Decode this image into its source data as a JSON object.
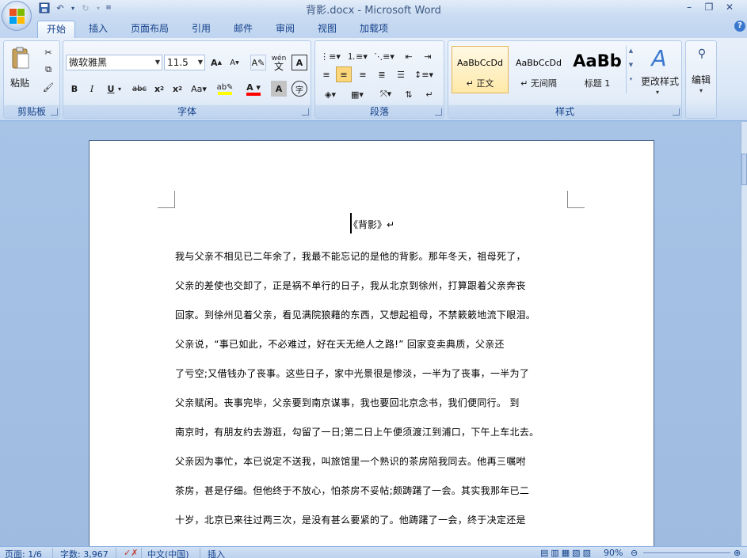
{
  "window": {
    "title": "背影.docx - Microsoft Word"
  },
  "tabs": [
    "开始",
    "插入",
    "页面布局",
    "引用",
    "邮件",
    "审阅",
    "视图",
    "加载项"
  ],
  "ribbon": {
    "clipboard": {
      "label": "剪贴板",
      "paste": "粘贴"
    },
    "font": {
      "label": "字体",
      "name": "微软雅黑",
      "size": "11.5",
      "phonetic": "wén",
      "phonetic_char": "文"
    },
    "paragraph": {
      "label": "段落"
    },
    "styles": {
      "label": "样式",
      "items": [
        {
          "sample": "AaBbCcDd",
          "name": "↵ 正文"
        },
        {
          "sample": "AaBbCcDd",
          "name": "↵ 无间隔"
        },
        {
          "sample": "AaBb",
          "name": "标题 1"
        }
      ],
      "change": "更改样式"
    },
    "editing": {
      "label": "编辑"
    }
  },
  "document": {
    "title": "《背影》↵",
    "lines": [
      "我与父亲不相见已二年余了，我最不能忘记的是他的背影。那年冬天，祖母死了，",
      "父亲的差使也交卸了，正是祸不单行的日子，我从北京到徐州，打算跟着父亲奔丧",
      "回家。到徐州见着父亲，看见满院狼藉的东西，又想起祖母，不禁簌簌地流下眼泪。",
      "父亲说，“事已如此，不必难过，好在天无绝人之路!”          回家变卖典质，父亲还",
      "了亏空;又借钱办了丧事。这些日子，家中光景很是惨淡，一半为了丧事，一半为了",
      "父亲赋闲。丧事完毕，父亲要到南京谋事，我也要回北京念书，我们便同行。          到",
      "南京时，有朋友约去游逛，勾留了一日;第二日上午便须渡江到浦口，下午上车北去。",
      "父亲因为事忙，本已说定不送我，叫旅馆里一个熟识的茶房陪我同去。他再三嘱咐",
      "茶房，甚是仔细。但他终于不放心，怕茶房不妥帖;颇踌躇了一会。其实我那年已二",
      "十岁，北京已来往过两三次，是没有甚么要紧的了。他踌躇了一会，终于决定还是"
    ]
  },
  "statusbar": {
    "page": "页面: 1/6",
    "words": "字数: 3,967",
    "language": "中文(中国)",
    "mode": "插入",
    "zoom": "90%"
  },
  "colors": {
    "highlight": "#ffff00",
    "font_color": "#ff0000",
    "accent": "#15428b"
  }
}
